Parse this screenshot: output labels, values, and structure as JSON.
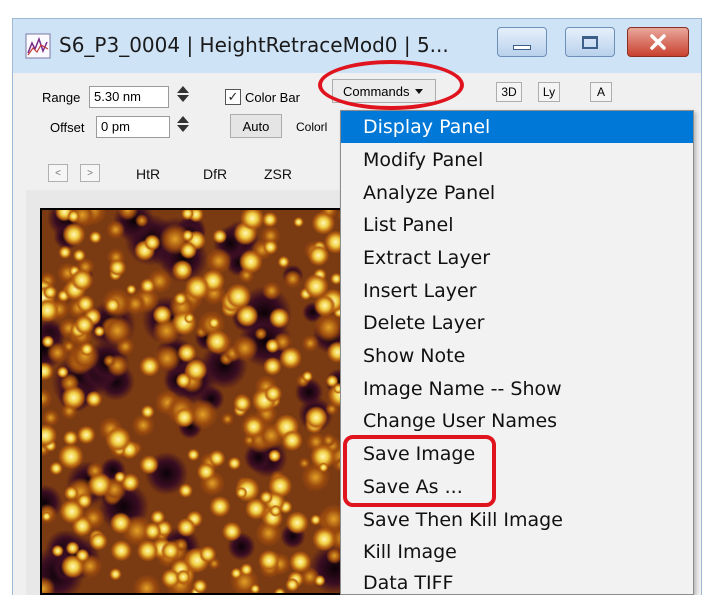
{
  "window": {
    "title": "S6_P3_0004 | HeightRetraceMod0 | 5..."
  },
  "controls": {
    "range_label": "Range",
    "range_value": "5.30 nm",
    "offset_label": "Offset",
    "offset_value": "0 pm",
    "colorbar_label": "Color Bar",
    "colorbar_checked": "✓",
    "auto_label": "Auto",
    "color_label": "Colorl",
    "commands_label": "Commands",
    "btn_3d": "3D",
    "btn_ly": "Ly",
    "btn_a": "A"
  },
  "tabs": {
    "prev": "<",
    "next": ">",
    "items": [
      "HtR",
      "DfR",
      "ZSR"
    ]
  },
  "menu": {
    "items": [
      "Display Panel",
      "Modify Panel",
      "Analyze Panel",
      "List Panel",
      "Extract Layer",
      "Insert Layer",
      "Delete Layer",
      "Show Note",
      "Image Name -- Show",
      "Change User Names",
      "Save Image",
      "Save As ...",
      "Save Then Kill Image",
      "Kill Image",
      "Data TIFF"
    ],
    "highlighted_index": 0
  },
  "colors": {
    "highlight": "#0078d7",
    "annotation": "#e0141e",
    "close_button": "#c9412e",
    "afm_low": "#1a0510",
    "afm_mid": "#b8620d",
    "afm_high": "#fff6a0"
  }
}
